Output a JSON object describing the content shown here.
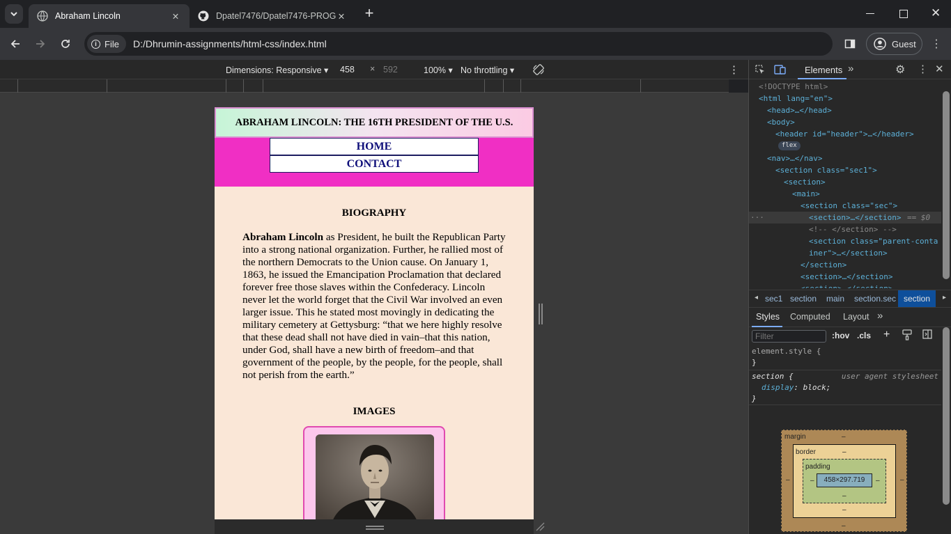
{
  "browser": {
    "tabs": [
      {
        "title": "Abraham Lincoln",
        "active": true
      },
      {
        "title": "Dpatel7476/Dpatel7476-PROG",
        "active": false
      }
    ],
    "new_tab": "+",
    "url_chip": "File",
    "url": "D:/Dhrumin-assignments/html-css/index.html",
    "profile": "Guest"
  },
  "device_toolbar": {
    "dimensions": "Dimensions: Responsive",
    "width": "458",
    "times": "×",
    "height": "592",
    "zoom": "100%",
    "throttle": "No throttling"
  },
  "page": {
    "header_title": "ABRAHAM LINCOLN: THE 16TH PRESIDENT OF THE U.S.",
    "nav": [
      "HOME",
      "CONTACT"
    ],
    "bio_heading": "BIOGRAPHY",
    "bio_bold": "Abraham Lincoln",
    "bio_text": " as President, he built the Republican Party into a strong national organization. Further, he rallied most of the northern Democrats to the Union cause. On January 1, 1863, he issued the Emancipation Proclamation that declared forever free those slaves within the Confederacy. Lincoln never let the world forget that the Civil War involved an even larger issue. This he stated most movingly in dedicating the military cemetery at Gettysburg: “that we here highly resolve that these dead shall not have died in vain–that this nation, under God, shall have a new birth of freedom–and that government of the people, by the people, for the people, shall not perish from the earth.”",
    "images_heading": "IMAGES"
  },
  "devtools": {
    "tab_elements": "Elements",
    "dom": [
      {
        "text": "<!DOCTYPE html>"
      },
      {
        "text": "<html lang=\"en\">"
      },
      {
        "text": "<head>…</head>"
      },
      {
        "text": "<body>"
      },
      {
        "text": "<header id=\"header\">…</header>"
      },
      {
        "text": "flex"
      },
      {
        "text": "<nav>…</nav>"
      },
      {
        "text": "<section class=\"sec1\">"
      },
      {
        "text": "<section>"
      },
      {
        "text": "<main>"
      },
      {
        "text": "<section class=\"sec\">"
      },
      {
        "text": "<section>…</section>"
      },
      {
        "text": "== $0"
      },
      {
        "text": "<!-- </section> -->"
      },
      {
        "text": "<section class=\"parent-conta"
      },
      {
        "text": "iner\">…</section>"
      },
      {
        "text": "</section>"
      },
      {
        "text": "<section>…</section>"
      },
      {
        "text": "<section>…</section>"
      }
    ],
    "breadcrumbs": [
      "sec1",
      "section",
      "main",
      "section.sec",
      "section"
    ],
    "style_tabs": [
      "Styles",
      "Computed",
      "Layout"
    ],
    "filter_placeholder": "Filter",
    "hov": ":hov",
    "cls": ".cls",
    "element_style": "element.style {",
    "close_brace": "}",
    "rule_selector": "section {",
    "rule_source": "user agent stylesheet",
    "rule_prop": "display",
    "rule_val": "block;",
    "box": {
      "margin": "margin",
      "border": "border",
      "padding": "padding",
      "content": "458×297.719",
      "dash": "–"
    }
  }
}
